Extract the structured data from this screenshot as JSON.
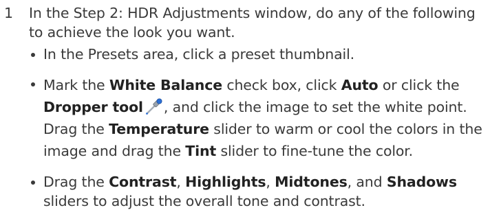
{
  "step": {
    "number": "1",
    "text": "In the Step 2: HDR Adjustments window, do any of the following to achieve the look you want."
  },
  "bullets": {
    "presets": {
      "t1": "In the Presets area, click a preset thumbnail."
    },
    "white_balance": {
      "t1": "Mark the ",
      "b1": "White Balance",
      "t2": " check box, click ",
      "b2": "Auto",
      "t3": " or click the ",
      "b3": "Dropper tool",
      "t4": ", and click the image to set the white point. Drag the ",
      "b4": "Temperature",
      "t5": " slider to warm or cool the colors in the image and drag the ",
      "b5": "Tint",
      "t6": " slider to fine-tune the color.",
      "icon": "dropper-icon"
    },
    "tone": {
      "t1": "Drag the ",
      "b1": "Contrast",
      "t2": ", ",
      "b2": "Highlights",
      "t3": ", ",
      "b3": "Midtones",
      "t4": ", and ",
      "b4": "Shadows",
      "t5": " sliders to adjust the overall tone and contrast."
    }
  },
  "colors": {
    "text": "#3a3a3a",
    "bold_text": "#222222",
    "dropper_body": "#9aa3ad",
    "dropper_tip": "#2b6fd6"
  }
}
